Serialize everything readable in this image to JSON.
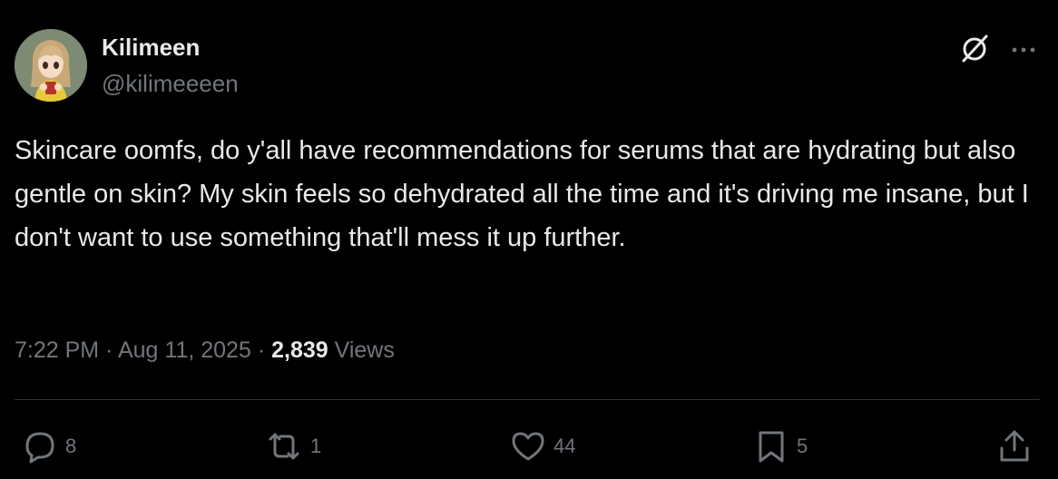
{
  "author": {
    "display_name": "Kilimeen",
    "handle": "@kilimeeeen"
  },
  "tweet": {
    "text": "Skincare oomfs, do y'all have recommendations for serums that are hydrating but also gentle on skin? My skin feels so dehydrated all the time and it's driving me insane, but I don't want to use something that'll mess it up further.",
    "time": "7:22 PM",
    "date": "Aug 11, 2025",
    "separator": "·",
    "views_count": "2,839",
    "views_label": "Views"
  },
  "actions": {
    "replies": "8",
    "reposts": "1",
    "likes": "44",
    "bookmarks": "5"
  },
  "icons": [
    "grok-icon",
    "more-icon",
    "reply-icon",
    "repost-icon",
    "like-icon",
    "bookmark-icon",
    "share-icon"
  ],
  "colors": {
    "background": "#000000",
    "text_primary": "#e7e9ea",
    "text_secondary": "#71767b",
    "divider": "#2f3336"
  }
}
